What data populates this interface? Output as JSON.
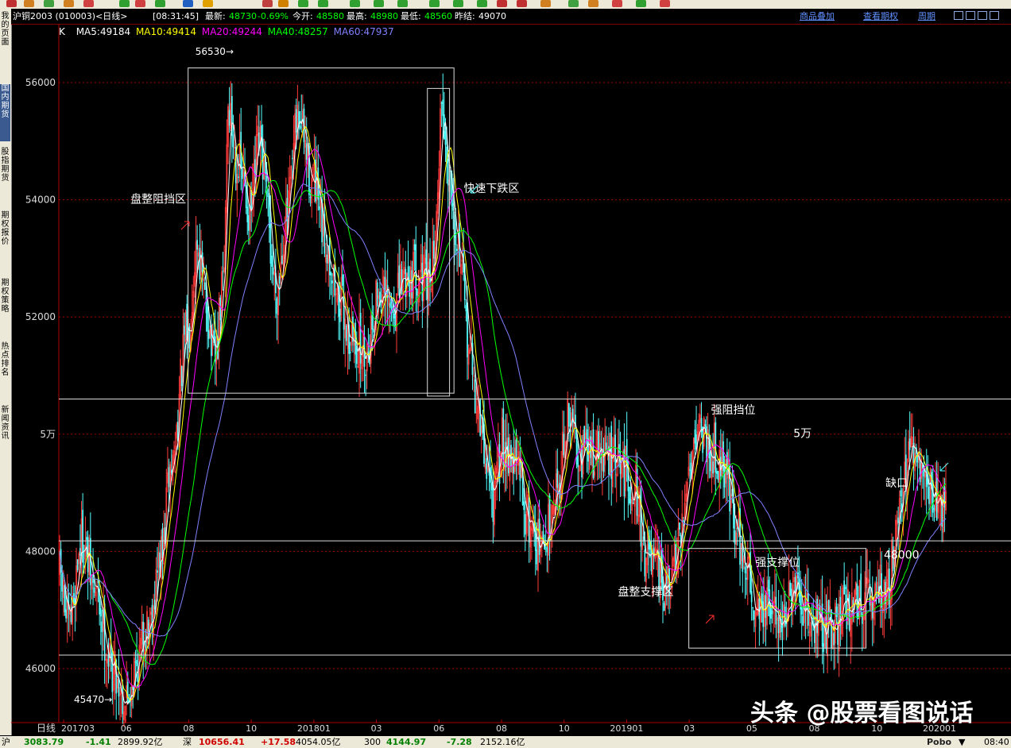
{
  "header": {
    "title": "沪铜2003 (010003)<日线>",
    "time": "[08:31:45]",
    "latest_label": "最新:",
    "latest_value": "48730",
    "change": "-0.69%",
    "open_label": "今开:",
    "open_value": "48580",
    "high_label": "最高:",
    "high_value": "48980",
    "low_label": "最低:",
    "low_value": "48560",
    "prev_label": "昨结:",
    "prev_value": "49070",
    "links": [
      "商品叠加",
      "查看期权",
      "周期"
    ]
  },
  "sidebar": {
    "tabs": [
      "我的页面",
      "国内期货",
      "股指期货",
      "期权报价",
      "期权策略",
      "热点排名",
      "新闻资讯"
    ]
  },
  "ma_legend": {
    "k_label": "K",
    "items": [
      {
        "label": "MA5:49184",
        "color": "#ffffff"
      },
      {
        "label": "MA10:49414",
        "color": "#ffff00"
      },
      {
        "label": "MA20:49244",
        "color": "#ff00ff"
      },
      {
        "label": "MA40:48257",
        "color": "#00ff00"
      },
      {
        "label": "MA60:47937",
        "color": "#8080ff"
      }
    ]
  },
  "chart_data": {
    "type": "candlestick",
    "title": "沪铜2003 日线",
    "y_ticks": [
      {
        "value": 46000,
        "label": "46000"
      },
      {
        "value": 48000,
        "label": "48000"
      },
      {
        "value": 50000,
        "label": "5万"
      },
      {
        "value": 52000,
        "label": "52000"
      },
      {
        "value": 54000,
        "label": "54000"
      },
      {
        "value": 56000,
        "label": "56000"
      }
    ],
    "ylim": [
      44800,
      57500
    ],
    "x_axis_label": "日线",
    "x_ticks": [
      "201703",
      "06",
      "08",
      "10",
      "201801",
      "03",
      "06",
      "08",
      "10",
      "201901",
      "03",
      "05",
      "08",
      "10",
      "202001"
    ],
    "price_path": [
      [
        0,
        47600
      ],
      [
        0.01,
        46700
      ],
      [
        0.025,
        48200
      ],
      [
        0.04,
        47300
      ],
      [
        0.06,
        46000
      ],
      [
        0.075,
        45470
      ],
      [
        0.085,
        46000
      ],
      [
        0.1,
        46800
      ],
      [
        0.115,
        47900
      ],
      [
        0.125,
        49400
      ],
      [
        0.145,
        51800
      ],
      [
        0.155,
        53300
      ],
      [
        0.165,
        52200
      ],
      [
        0.175,
        51200
      ],
      [
        0.185,
        52600
      ],
      [
        0.19,
        55600
      ],
      [
        0.2,
        54700
      ],
      [
        0.215,
        53800
      ],
      [
        0.225,
        54900
      ],
      [
        0.245,
        52500
      ],
      [
        0.255,
        53600
      ],
      [
        0.27,
        55400
      ],
      [
        0.285,
        54300
      ],
      [
        0.3,
        53300
      ],
      [
        0.315,
        52300
      ],
      [
        0.33,
        51600
      ],
      [
        0.345,
        51400
      ],
      [
        0.36,
        52400
      ],
      [
        0.375,
        52100
      ],
      [
        0.39,
        52700
      ],
      [
        0.405,
        52800
      ],
      [
        0.415,
        52500
      ],
      [
        0.425,
        53400
      ],
      [
        0.43,
        55600
      ],
      [
        0.44,
        54500
      ],
      [
        0.45,
        53300
      ],
      [
        0.46,
        51700
      ],
      [
        0.47,
        50600
      ],
      [
        0.48,
        49600
      ],
      [
        0.49,
        48900
      ],
      [
        0.5,
        49900
      ],
      [
        0.515,
        49500
      ],
      [
        0.53,
        48500
      ],
      [
        0.545,
        48000
      ],
      [
        0.56,
        49100
      ],
      [
        0.575,
        50200
      ],
      [
        0.59,
        49700
      ],
      [
        0.605,
        49700
      ],
      [
        0.62,
        49600
      ],
      [
        0.635,
        49400
      ],
      [
        0.65,
        49100
      ],
      [
        0.66,
        48000
      ],
      [
        0.67,
        47700
      ],
      [
        0.685,
        47300
      ],
      [
        0.7,
        48000
      ],
      [
        0.71,
        49500
      ],
      [
        0.72,
        50200
      ],
      [
        0.735,
        49800
      ],
      [
        0.75,
        49500
      ],
      [
        0.765,
        48300
      ],
      [
        0.775,
        47700
      ],
      [
        0.785,
        47100
      ],
      [
        0.8,
        47000
      ],
      [
        0.815,
        46900
      ],
      [
        0.83,
        47200
      ],
      [
        0.845,
        46900
      ],
      [
        0.86,
        46700
      ],
      [
        0.875,
        46800
      ],
      [
        0.89,
        47100
      ],
      [
        0.905,
        47200
      ],
      [
        0.915,
        47100
      ],
      [
        0.925,
        47400
      ],
      [
        0.935,
        47300
      ],
      [
        0.945,
        48700
      ],
      [
        0.96,
        49600
      ],
      [
        0.975,
        49300
      ],
      [
        0.985,
        49000
      ],
      [
        1,
        48730
      ]
    ],
    "ma_colors": {
      "MA5": "#ffffff",
      "MA10": "#ffff00",
      "MA20": "#ff00ff",
      "MA40": "#00ff00",
      "MA60": "#8080ff"
    },
    "up_color": "#ff3c3c",
    "down_color": "#54ffff",
    "markers": [
      {
        "label": "56530",
        "value": 56530,
        "t": 0.2
      },
      {
        "label": "45470",
        "value": 45470,
        "t": 0.063
      }
    ],
    "h_lines": [
      50600,
      48180,
      46230
    ],
    "regions": [
      {
        "t0": 0.145,
        "t1": 0.445,
        "v0": 50700,
        "v1": 56250
      },
      {
        "t0": 0.415,
        "t1": 0.44,
        "v0": 50650,
        "v1": 55900
      },
      {
        "t0": 0.71,
        "t1": 0.91,
        "v0": 46350,
        "v1": 48050
      }
    ],
    "annotations": [
      {
        "text": "盘整阻挡区",
        "t": 0.08,
        "v": 53950
      },
      {
        "text": "快速下跌区",
        "t": 0.456,
        "v": 54130
      },
      {
        "text": "强阻挡位",
        "t": 0.735,
        "v": 50350
      },
      {
        "text": "5万",
        "t": 0.828,
        "v": 49950
      },
      {
        "text": "缺口",
        "t": 0.932,
        "v": 49100
      },
      {
        "text": "48000",
        "t": 0.93,
        "v": 47880
      },
      {
        "text": "强支撑位",
        "t": 0.785,
        "v": 47750
      },
      {
        "text": "盘整支撑区",
        "t": 0.63,
        "v": 47250
      }
    ]
  },
  "status_bar": {
    "sh_label": "沪",
    "sh_value": "3083.79",
    "sh_change": "-1.41",
    "sh_amount": "2899.92亿",
    "sz_label": "深",
    "sz_value": "10656.41",
    "sz_change": "+17.58",
    "sz_amount": "4054.05亿",
    "hs300_label": "300",
    "hs300_value": "4144.97",
    "hs300_change": "-7.28",
    "hs300_amount": "2152.16亿",
    "brand": "Pobo",
    "clock": "08:40"
  },
  "watermark": "头条 @股票看图说话",
  "colors": {
    "accent": "#5f8fff",
    "grid": "#800000",
    "background": "#000000"
  }
}
